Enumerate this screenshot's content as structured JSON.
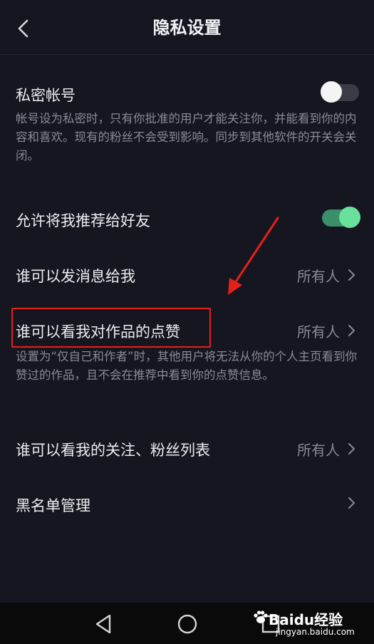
{
  "header": {
    "back_icon": "chevron-left-icon",
    "title": "隐私设置"
  },
  "settings": {
    "private_account": {
      "title": "私密帐号",
      "description": "帐号设为私密时，只有你批准的用户才能关注你，并能看到你的内容和喜欢。现有的粉丝不会受到影响。同步到其他软件的开关会关闭。",
      "enabled": false
    },
    "recommend_to_friends": {
      "title": "允许将我推荐给好友",
      "enabled": true
    },
    "who_can_message": {
      "title": "谁可以发消息给我",
      "value": "所有人"
    },
    "who_can_see_likes": {
      "title": "谁可以看我对作品的点赞",
      "value": "所有人",
      "description": "设置为“仅自己和作者”时，其他用户将无法从你的个人主页看到你赞过的作品，且不会在推荐中看到你的点赞信息。"
    },
    "who_can_see_follow_list": {
      "title": "谁可以看我的关注、粉丝列表",
      "value": "所有人"
    },
    "blacklist": {
      "title": "黑名单管理"
    }
  },
  "annotation": {
    "highlight_color": "#E3211A",
    "arrow_color": "#E3211A"
  },
  "colors": {
    "background": "#161620",
    "toggle_on_track": "#3A8F6A",
    "toggle_on_knob": "#67E19B"
  },
  "navbar": {
    "icons": [
      "back-triangle-icon",
      "home-circle-icon",
      "recents-square-icon"
    ]
  },
  "watermark": {
    "brand": "Baidu经验",
    "url": "jingyan.baidu.com"
  }
}
